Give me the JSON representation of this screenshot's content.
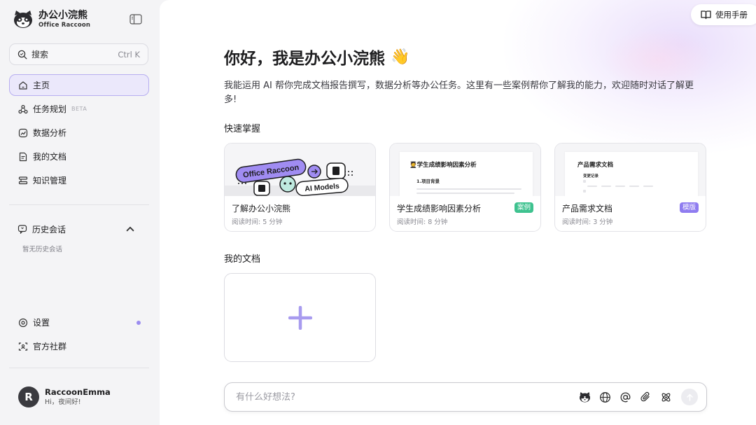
{
  "brand": {
    "name": "办公小浣熊",
    "subtitle": "Office Raccoon"
  },
  "search": {
    "label": "搜索",
    "shortcut": "Ctrl K"
  },
  "nav": [
    {
      "label": "主页",
      "icon": "home-icon",
      "active": true
    },
    {
      "label": "任务规划",
      "icon": "task-plan-icon",
      "badge": "BETA"
    },
    {
      "label": "数据分析",
      "icon": "data-analysis-icon"
    },
    {
      "label": "我的文档",
      "icon": "document-icon"
    },
    {
      "label": "知识管理",
      "icon": "knowledge-icon"
    }
  ],
  "history": {
    "title": "历史会话",
    "empty": "暂无历史会话"
  },
  "bottom_nav": [
    {
      "label": "设置",
      "icon": "settings-icon"
    },
    {
      "label": "官方社群",
      "icon": "community-icon"
    }
  ],
  "user": {
    "initial": "R",
    "name": "RaccoonEmma",
    "greeting": "Hi，夜间好!"
  },
  "header": {
    "manual": "使用手册"
  },
  "main": {
    "greeting": "你好，我是办公小浣熊",
    "greeting_emoji": "👋",
    "intro": "我能运用 AI 帮你完成文档报告撰写，数据分析等办公任务。这里有一些案例帮你了解我的能力，欢迎随时对话了解更多!",
    "quick_title": "快速掌握",
    "docs_title": "我的文档"
  },
  "cards": [
    {
      "title": "了解办公小浣熊",
      "meta": "阅读时间: 5 分钟",
      "tag": "",
      "thumb_text_1": "Office Raccoon",
      "thumb_text_2": "AI Models"
    },
    {
      "title": "学生成绩影响因素分析",
      "meta": "阅读时间: 8 分钟",
      "tag": "案例",
      "thumb_title": "🧑‍🎓学生成绩影响因素分析",
      "thumb_sub": "1.项目背景"
    },
    {
      "title": "产品需求文档",
      "meta": "阅读时间: 3 分钟",
      "tag": "模版",
      "thumb_title": "产品需求文档",
      "thumb_sub": "变更记录"
    }
  ],
  "composer": {
    "placeholder": "有什么好想法?"
  },
  "colors": {
    "accent": "#8f7cf0",
    "tag_green": "#3ec28f",
    "active_bg": "#ebe8fb"
  }
}
